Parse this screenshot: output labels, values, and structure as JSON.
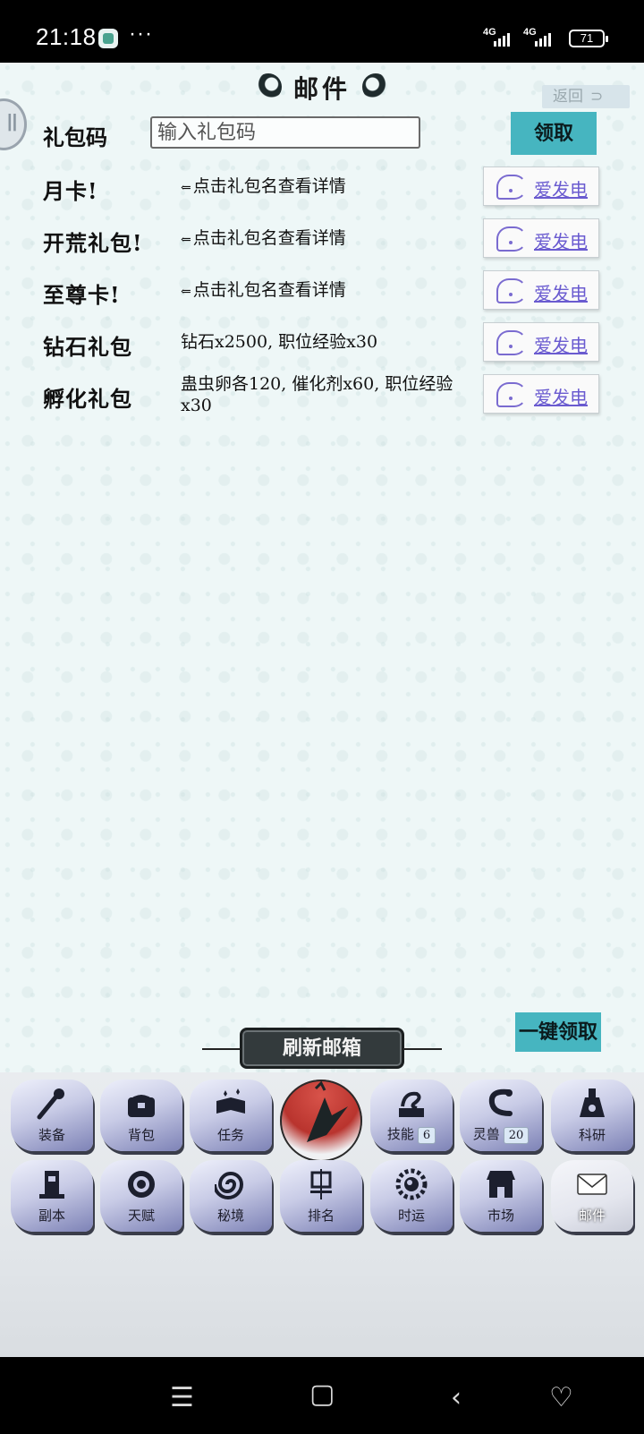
{
  "status_bar": {
    "time": "21:18",
    "dots": "···",
    "signal1": "4G",
    "signal2": "4G",
    "battery": "71"
  },
  "header": {
    "title": "邮件",
    "back_label": "返回",
    "back_arrow": "⊃"
  },
  "gift_code": {
    "label": "礼包码",
    "placeholder": "输入礼包码",
    "value": "",
    "claim_label": "领取"
  },
  "packages": [
    {
      "name": "月卡!",
      "hint_arrow": "⇐",
      "desc": "点击礼包名查看详情",
      "button": "爱发电"
    },
    {
      "name": "开荒礼包!",
      "hint_arrow": "⇐",
      "desc": "点击礼包名查看详情",
      "button": "爱发电"
    },
    {
      "name": "至尊卡!",
      "hint_arrow": "⇐",
      "desc": "点击礼包名查看详情",
      "button": "爱发电"
    },
    {
      "name": "钻石礼包",
      "hint_arrow": "",
      "desc": "钻石x2500, 职位经验x30",
      "button": "爱发电"
    },
    {
      "name": "孵化礼包",
      "hint_arrow": "",
      "desc": "蛊虫卵各120, 催化剂x60, 职位经验x30",
      "button": "爱发电"
    }
  ],
  "actions": {
    "refresh_label": "刷新邮箱",
    "claim_all_label": "一键领取"
  },
  "menu": {
    "row1": [
      {
        "label": "装备",
        "icon": "torch-icon"
      },
      {
        "label": "背包",
        "icon": "chest-icon"
      },
      {
        "label": "任务",
        "icon": "book-icon"
      },
      {
        "label": "技能",
        "badge": "6",
        "icon": "dragon-book-icon"
      },
      {
        "label": "灵兽",
        "badge": "20",
        "icon": "serpent-icon"
      },
      {
        "label": "科研",
        "icon": "flask-icon"
      }
    ],
    "row2": [
      {
        "label": "副本",
        "icon": "totem-icon"
      },
      {
        "label": "天赋",
        "icon": "wheel-icon"
      },
      {
        "label": "秘境",
        "icon": "spiral-icon"
      },
      {
        "label": "排名",
        "icon": "banner-icon"
      },
      {
        "label": "时运",
        "icon": "fortune-icon"
      },
      {
        "label": "市场",
        "icon": "shop-icon"
      },
      {
        "label": "邮件",
        "icon": "mail-icon"
      }
    ]
  },
  "colors": {
    "accent_teal": "#46b5c0",
    "link_purple": "#6a5bd0",
    "emblem_red": "#b9342e"
  }
}
